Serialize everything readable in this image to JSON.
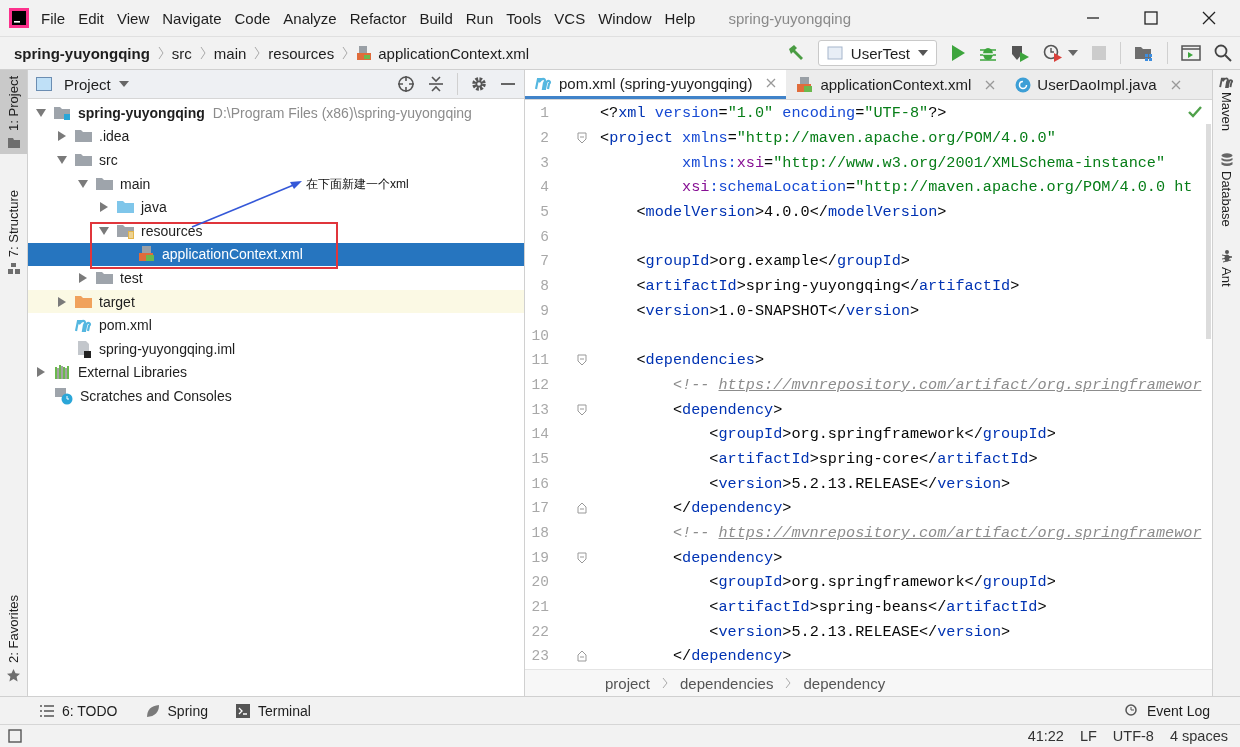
{
  "window": {
    "title": "spring-yuyongqing"
  },
  "menu": [
    "File",
    "Edit",
    "View",
    "Navigate",
    "Code",
    "Analyze",
    "Refactor",
    "Build",
    "Run",
    "Tools",
    "VCS",
    "Window",
    "Help"
  ],
  "nav_path": [
    {
      "label": "spring-yuyongqing",
      "kind": "project"
    },
    {
      "label": "src",
      "kind": "folder"
    },
    {
      "label": "main",
      "kind": "folder"
    },
    {
      "label": "resources",
      "kind": "folder"
    },
    {
      "label": "applicationContext.xml",
      "kind": "xml"
    }
  ],
  "toolbar": {
    "run_config": "UserTest",
    "buttons": [
      {
        "kind": "build",
        "disabled": false
      },
      {
        "kind": "run",
        "disabled": false
      },
      {
        "kind": "debug",
        "disabled": false
      },
      {
        "kind": "coverage",
        "disabled": false
      },
      {
        "kind": "profile",
        "disabled": false
      },
      {
        "kind": "stop",
        "disabled": true
      },
      {
        "kind": "structure",
        "disabled": false
      },
      {
        "kind": "console",
        "disabled": false
      },
      {
        "kind": "search",
        "disabled": false
      }
    ]
  },
  "left_stripe": [
    {
      "label": "1: Project",
      "selected": true,
      "kind": "project"
    },
    {
      "label": "7: Structure",
      "selected": false,
      "kind": "structure"
    },
    {
      "label": "2: Favorites",
      "selected": false,
      "kind": "favorites"
    }
  ],
  "project_panel": {
    "title": "Project",
    "tree": [
      {
        "label": "spring-yuyongqing",
        "hint": "D:\\Program Files (x86)\\spring-yuyongqing",
        "kind": "module",
        "expanded": true,
        "selected": false,
        "highlighted": false,
        "children": [
          {
            "label": ".idea",
            "kind": "folder",
            "expanded": false,
            "selected": false,
            "highlighted": false
          },
          {
            "label": "src",
            "kind": "folder",
            "expanded": true,
            "selected": false,
            "highlighted": false,
            "children": [
              {
                "label": "main",
                "kind": "folder",
                "expanded": true,
                "selected": false,
                "highlighted": false,
                "children": [
                  {
                    "label": "java",
                    "kind": "source-folder",
                    "expanded": false,
                    "selected": false,
                    "highlighted": false
                  },
                  {
                    "label": "resources",
                    "kind": "resource-folder",
                    "expanded": true,
                    "selected": false,
                    "highlighted": false,
                    "children": [
                      {
                        "label": "applicationContext.xml",
                        "kind": "xml",
                        "selected": true,
                        "highlighted": false
                      }
                    ]
                  }
                ]
              },
              {
                "label": "test",
                "kind": "folder",
                "expanded": false,
                "selected": false,
                "highlighted": false
              }
            ]
          },
          {
            "label": "target",
            "kind": "excluded-folder",
            "expanded": false,
            "selected": false,
            "highlighted": true
          },
          {
            "label": "pom.xml",
            "kind": "maven",
            "selected": false,
            "highlighted": false
          },
          {
            "label": "spring-yuyongqing.iml",
            "kind": "iml",
            "selected": false,
            "highlighted": false
          }
        ]
      },
      {
        "label": "External Libraries",
        "kind": "libraries",
        "expanded": false,
        "selected": false,
        "highlighted": false
      },
      {
        "label": "Scratches and Consoles",
        "kind": "scratches",
        "selected": false,
        "highlighted": false
      }
    ],
    "annotation": "在下面新建一个xml"
  },
  "editor": {
    "tabs": [
      {
        "label": "pom.xml (spring-yuyongqing)",
        "kind": "maven",
        "selected": true
      },
      {
        "label": "applicationContext.xml",
        "kind": "xml",
        "selected": false
      },
      {
        "label": "UserDaoImpl.java",
        "kind": "class",
        "selected": false
      }
    ],
    "lines": [
      {
        "number": "1",
        "tokens": [
          {
            "kind": "p",
            "text": "<?"
          },
          {
            "kind": "tag",
            "text": "xml"
          },
          {
            "kind": "attr",
            "text": " version"
          },
          {
            "kind": "p",
            "text": "="
          },
          {
            "kind": "str",
            "text": "\"1.0\""
          },
          {
            "kind": "attr",
            "text": " encoding"
          },
          {
            "kind": "p",
            "text": "="
          },
          {
            "kind": "str",
            "text": "\"UTF-8\""
          },
          {
            "kind": "p",
            "text": "?>"
          }
        ]
      },
      {
        "number": "2",
        "kind": "fold-start",
        "tokens": [
          {
            "kind": "p",
            "text": "<"
          },
          {
            "kind": "tag",
            "text": "project"
          },
          {
            "kind": "attr",
            "text": " xmlns"
          },
          {
            "kind": "p",
            "text": "="
          },
          {
            "kind": "str",
            "text": "\"http://maven.apache.org/POM/4.0.0\""
          }
        ]
      },
      {
        "number": "3",
        "tokens": [
          {
            "kind": "attr",
            "text": "         xmlns:"
          },
          {
            "kind": "ns",
            "text": "xsi"
          },
          {
            "kind": "p",
            "text": "="
          },
          {
            "kind": "str",
            "text": "\"http://www.w3.org/2001/XMLSchema-instance\""
          }
        ]
      },
      {
        "number": "4",
        "tokens": [
          {
            "kind": "ns",
            "text": "         xsi"
          },
          {
            "kind": "attr",
            "text": ":schemaLocation"
          },
          {
            "kind": "p",
            "text": "="
          },
          {
            "kind": "str",
            "text": "\"http://maven.apache.org/POM/4.0.0 ht"
          }
        ]
      },
      {
        "number": "5",
        "tokens": [
          {
            "kind": "p",
            "text": "    <"
          },
          {
            "kind": "tag",
            "text": "modelVersion"
          },
          {
            "kind": "p",
            "text": ">4.0.0</"
          },
          {
            "kind": "tag",
            "text": "modelVersion"
          },
          {
            "kind": "p",
            "text": ">"
          }
        ]
      },
      {
        "number": "6"
      },
      {
        "number": "7",
        "tokens": [
          {
            "kind": "p",
            "text": "    <"
          },
          {
            "kind": "tag",
            "text": "groupId"
          },
          {
            "kind": "p",
            "text": ">org.example</"
          },
          {
            "kind": "tag",
            "text": "groupId"
          },
          {
            "kind": "p",
            "text": ">"
          }
        ]
      },
      {
        "number": "8",
        "tokens": [
          {
            "kind": "p",
            "text": "    <"
          },
          {
            "kind": "tag",
            "text": "artifactId"
          },
          {
            "kind": "p",
            "text": ">spring-yuyongqing</"
          },
          {
            "kind": "tag",
            "text": "artifactId"
          },
          {
            "kind": "p",
            "text": ">"
          }
        ]
      },
      {
        "number": "9",
        "tokens": [
          {
            "kind": "p",
            "text": "    <"
          },
          {
            "kind": "tag",
            "text": "version"
          },
          {
            "kind": "p",
            "text": ">1.0-SNAPSHOT</"
          },
          {
            "kind": "tag",
            "text": "version"
          },
          {
            "kind": "p",
            "text": ">"
          }
        ]
      },
      {
        "number": "10"
      },
      {
        "number": "11",
        "kind": "fold-start",
        "tokens": [
          {
            "kind": "p",
            "text": "    <"
          },
          {
            "kind": "tag",
            "text": "dependencies"
          },
          {
            "kind": "p",
            "text": ">"
          }
        ]
      },
      {
        "number": "12",
        "tokens": [
          {
            "kind": "comment",
            "text": "        <!-- "
          },
          {
            "kind": "link",
            "text": "https://mvnrepository.com/artifact/org.springframewor"
          }
        ]
      },
      {
        "number": "13",
        "kind": "fold-start",
        "tokens": [
          {
            "kind": "p",
            "text": "        <"
          },
          {
            "kind": "tag",
            "text": "dependency"
          },
          {
            "kind": "p",
            "text": ">"
          }
        ]
      },
      {
        "number": "14",
        "tokens": [
          {
            "kind": "p",
            "text": "            <"
          },
          {
            "kind": "tag",
            "text": "groupId"
          },
          {
            "kind": "p",
            "text": ">org.springframework</"
          },
          {
            "kind": "tag",
            "text": "groupId"
          },
          {
            "kind": "p",
            "text": ">"
          }
        ]
      },
      {
        "number": "15",
        "tokens": [
          {
            "kind": "p",
            "text": "            <"
          },
          {
            "kind": "tag",
            "text": "artifactId"
          },
          {
            "kind": "p",
            "text": ">spring-core</"
          },
          {
            "kind": "tag",
            "text": "artifactId"
          },
          {
            "kind": "p",
            "text": ">"
          }
        ]
      },
      {
        "number": "16",
        "tokens": [
          {
            "kind": "p",
            "text": "            <"
          },
          {
            "kind": "tag",
            "text": "version"
          },
          {
            "kind": "p",
            "text": ">5.2.13.RELEASE</"
          },
          {
            "kind": "tag",
            "text": "version"
          },
          {
            "kind": "p",
            "text": ">"
          }
        ]
      },
      {
        "number": "17",
        "kind": "fold-end",
        "tokens": [
          {
            "kind": "p",
            "text": "        </"
          },
          {
            "kind": "tag",
            "text": "dependency"
          },
          {
            "kind": "p",
            "text": ">"
          }
        ]
      },
      {
        "number": "18",
        "tokens": [
          {
            "kind": "comment",
            "text": "        <!-- "
          },
          {
            "kind": "link",
            "text": "https://mvnrepository.com/artifact/org.springframewor"
          }
        ]
      },
      {
        "number": "19",
        "kind": "fold-start",
        "tokens": [
          {
            "kind": "p",
            "text": "        <"
          },
          {
            "kind": "tag",
            "text": "dependency"
          },
          {
            "kind": "p",
            "text": ">"
          }
        ]
      },
      {
        "number": "20",
        "tokens": [
          {
            "kind": "p",
            "text": "            <"
          },
          {
            "kind": "tag",
            "text": "groupId"
          },
          {
            "kind": "p",
            "text": ">org.springframework</"
          },
          {
            "kind": "tag",
            "text": "groupId"
          },
          {
            "kind": "p",
            "text": ">"
          }
        ]
      },
      {
        "number": "21",
        "tokens": [
          {
            "kind": "p",
            "text": "            <"
          },
          {
            "kind": "tag",
            "text": "artifactId"
          },
          {
            "kind": "p",
            "text": ">spring-beans</"
          },
          {
            "kind": "tag",
            "text": "artifactId"
          },
          {
            "kind": "p",
            "text": ">"
          }
        ]
      },
      {
        "number": "22",
        "tokens": [
          {
            "kind": "p",
            "text": "            <"
          },
          {
            "kind": "tag",
            "text": "version"
          },
          {
            "kind": "p",
            "text": ">5.2.13.RELEASE</"
          },
          {
            "kind": "tag",
            "text": "version"
          },
          {
            "kind": "p",
            "text": ">"
          }
        ]
      },
      {
        "number": "23",
        "kind": "fold-end",
        "tokens": [
          {
            "kind": "p",
            "text": "        </"
          },
          {
            "kind": "tag",
            "text": "dependency"
          },
          {
            "kind": "p",
            "text": ">"
          }
        ]
      }
    ],
    "breadcrumbs": [
      "project",
      "dependencies",
      "dependency"
    ]
  },
  "right_stripe": [
    {
      "label": "Maven",
      "kind": "maven"
    },
    {
      "label": "Database",
      "kind": "database"
    },
    {
      "label": "Ant",
      "kind": "ant"
    }
  ],
  "tool_windows": [
    {
      "label": "6: TODO",
      "kind": "todo"
    },
    {
      "label": "Spring",
      "kind": "spring"
    },
    {
      "label": "Terminal",
      "kind": "terminal"
    }
  ],
  "event_log": "Event Log",
  "status_bar": [
    "41:22",
    "LF",
    "UTF-8",
    "4 spaces"
  ]
}
